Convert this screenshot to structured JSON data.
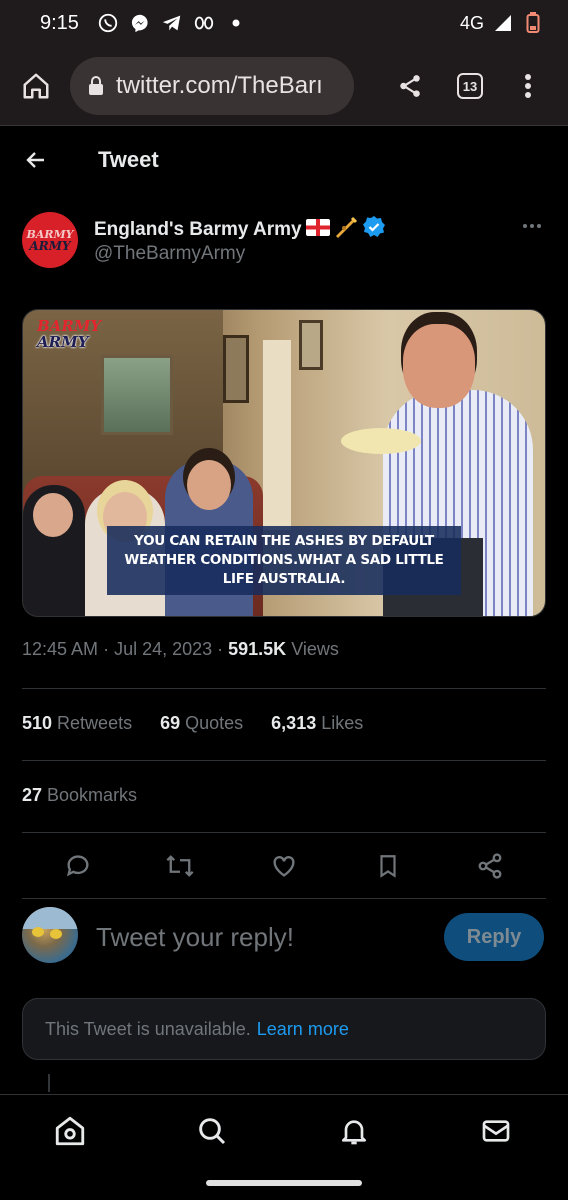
{
  "status_bar": {
    "time": "9:15",
    "network": "4G",
    "icons": [
      "whatsapp-icon",
      "messenger-icon",
      "telegram-icon",
      "abc-icon",
      "dot-icon",
      "signal-icon",
      "battery-low-icon"
    ]
  },
  "browser": {
    "url": "twitter.com/TheBarı",
    "tab_count": "13"
  },
  "header": {
    "title": "Tweet"
  },
  "author": {
    "name": "England's Barmy Army",
    "handle": "@TheBarmyArmy",
    "avatar_line1": "BARMY",
    "avatar_line2": "ARMY",
    "verified": true
  },
  "media": {
    "logo_line1": "BARMY",
    "logo_line2": "ARMY",
    "caption": "YOU CAN RETAIN THE ASHES BY DEFAULT WEATHER CONDITIONS.WHAT A SAD LITTLE LIFE AUSTRALIA."
  },
  "meta": {
    "time": "12:45 AM",
    "sep1": " · ",
    "date": "Jul 24, 2023",
    "sep2": " · ",
    "views_count": "591.5K",
    "views_label": " Views"
  },
  "stats": {
    "retweets_count": "510",
    "retweets_label": "Retweets",
    "quotes_count": "69",
    "quotes_label": "Quotes",
    "likes_count": "6,313",
    "likes_label": "Likes",
    "bookmarks_count": "27",
    "bookmarks_label": "Bookmarks"
  },
  "composer": {
    "placeholder": "Tweet your reply!",
    "reply_label": "Reply"
  },
  "unavailable": {
    "text": "This Tweet is unavailable.",
    "link": "Learn more"
  },
  "colors": {
    "accent": "#1d9bf0",
    "background": "#000000",
    "muted": "#71767b",
    "reply_button": "#0f4e7c"
  }
}
